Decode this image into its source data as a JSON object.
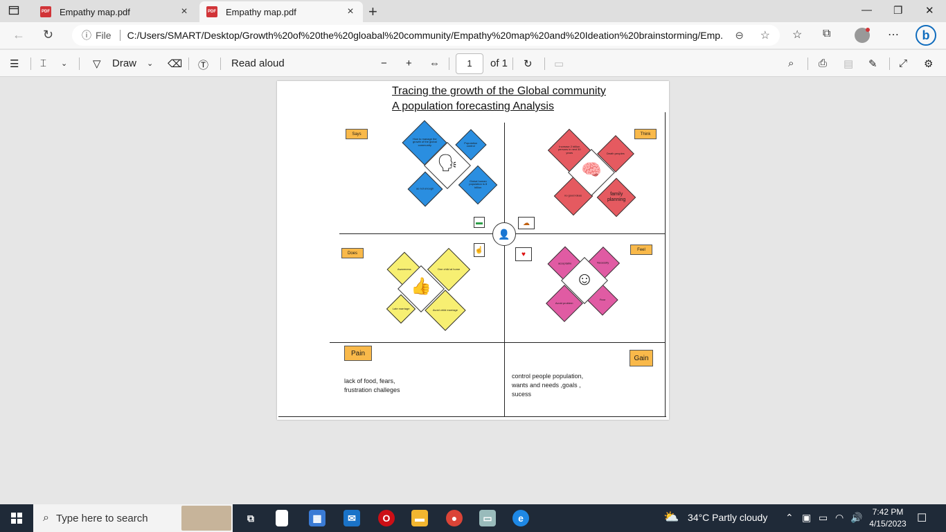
{
  "browser": {
    "tabs": [
      {
        "title": "Empathy map.pdf",
        "icon": "pdf-icon",
        "active": false
      },
      {
        "title": "Empathy map.pdf",
        "icon": "pdf-icon",
        "active": true
      }
    ],
    "address": {
      "info_label": "File",
      "url": "C:/Users/SMART/Desktop/Growth%20of%20the%20gloabal%20community/Empathy%20map%20and%20Ideation%20brainstorming/Emp..."
    }
  },
  "pdf_toolbar": {
    "draw_label": "Draw",
    "read_aloud_label": "Read aloud",
    "page_number": "1",
    "page_total": "of 1"
  },
  "document": {
    "title_line1": "Tracing the growth of the Global community",
    "title_line2": "A population forecasting Analysis",
    "quadrant_tags": {
      "says": "Says",
      "think": "Think",
      "does": "Does",
      "feel": "Feel"
    },
    "says_notes": [
      "How to manage the growth of the global community",
      "Population control",
      "Global human population is 8 billion",
      "as not enough"
    ],
    "think_notes": [
      "Increase 2 billion persons in next 30 years",
      "Death peoples",
      "family planning",
      "no good ideas"
    ],
    "does_notes": [
      "Awareness",
      "One child at home",
      "Late marriage",
      "Avoid child marriage"
    ],
    "feel_notes": [
      "acceptable",
      "Necessity",
      "Avoid problem",
      "Fear"
    ],
    "pain": {
      "label": "Pain",
      "text": "lack of food, fears, frustration  challeges"
    },
    "gain": {
      "label": "Gain",
      "text": "control people population,  wants and needs ,goals , sucess"
    }
  },
  "taskbar": {
    "search_placeholder": "Type here to search",
    "weather": "34°C  Partly cloudy",
    "time": "7:42 PM",
    "date": "4/15/2023"
  }
}
